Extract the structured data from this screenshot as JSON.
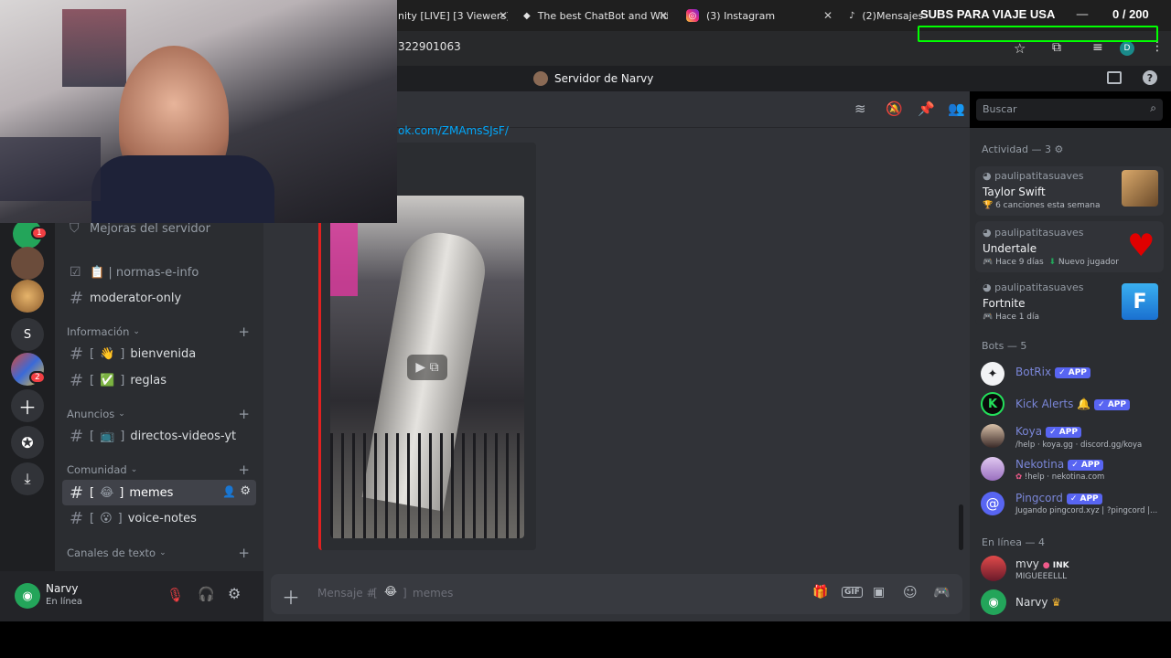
{
  "browser": {
    "tabs": [
      {
        "label": "nity [LIVE] [3 Viewers]"
      },
      {
        "label": "The best ChatBot and Wid"
      },
      {
        "label": "(3) Instagram"
      },
      {
        "label": "(2)Mensajes |"
      }
    ],
    "url": "322901063",
    "profile_initial": "D"
  },
  "overlay": {
    "subs_text": "SUBS PARA VIAJE USA",
    "counter": "0 / 200"
  },
  "server": {
    "name": "Servidor de Narvy"
  },
  "channels": {
    "boost_label": "Mejoras del servidor",
    "items": [
      {
        "label": "📋 | normas-e-info"
      },
      {
        "label": "moderator-only"
      }
    ],
    "categories": [
      {
        "label": "Información"
      },
      {
        "label": "Anuncios"
      },
      {
        "label": "Comunidad"
      },
      {
        "label": "Canales de texto"
      }
    ],
    "info": [
      {
        "emoji": "👋",
        "label": "bienvenida"
      },
      {
        "emoji": "✅",
        "label": "reglas"
      }
    ],
    "anuncios": [
      {
        "emoji": "📺",
        "label": "directos-videos-yt"
      }
    ],
    "comunidad": [
      {
        "emoji": "😂",
        "label": "memes"
      },
      {
        "emoji": "😮",
        "label": "voice-notes"
      }
    ]
  },
  "server_list": {
    "badges": [
      "1",
      "2"
    ],
    "letter_server": "S"
  },
  "user": {
    "name": "Narvy",
    "status": "En línea"
  },
  "chat": {
    "link_text": "ok.com/ZMAmsSJsF/",
    "composer_prefix": "Mensaje #",
    "composer_emoji": "😂",
    "composer_channel": "memes"
  },
  "search": {
    "placeholder": "Buscar"
  },
  "members": {
    "activity_header": "Actividad — 3",
    "activities": [
      {
        "user": "paulipatitasuaves",
        "title": "Taylor Swift",
        "detail": "6 canciones esta semana",
        "extra": ""
      },
      {
        "user": "paulipatitasuaves",
        "title": "Undertale",
        "detail": "Hace 9 días",
        "extra": "Nuevo jugador"
      },
      {
        "user": "paulipatitasuaves",
        "title": "Fortnite",
        "detail": "Hace 1 día",
        "extra": ""
      }
    ],
    "bots_header": "Bots — 5",
    "bots": [
      {
        "name": "BotRix",
        "sub": "",
        "app": "✓ APP"
      },
      {
        "name": "Kick Alerts",
        "sub": "",
        "app": "✓ APP"
      },
      {
        "name": "Koya",
        "sub": "/help · koya.gg · discord.gg/koya",
        "app": "✓ APP"
      },
      {
        "name": "Nekotina",
        "sub": "!help · nekotina.com",
        "app": "✓ APP"
      },
      {
        "name": "Pingcord",
        "sub": "Jugando pingcord.xyz | ?pingcord |...",
        "app": "✓ APP"
      }
    ],
    "online_header": "En línea — 4",
    "online": [
      {
        "name": "mvy",
        "tag": "INK",
        "sub": "MIGUEEELLL"
      },
      {
        "name": "Narvy",
        "tag": "",
        "sub": ""
      }
    ]
  },
  "colors": {
    "accent": "#5865f2",
    "online": "#23a55a",
    "link": "#00a8fc",
    "overlay_box": "#00ff00"
  }
}
